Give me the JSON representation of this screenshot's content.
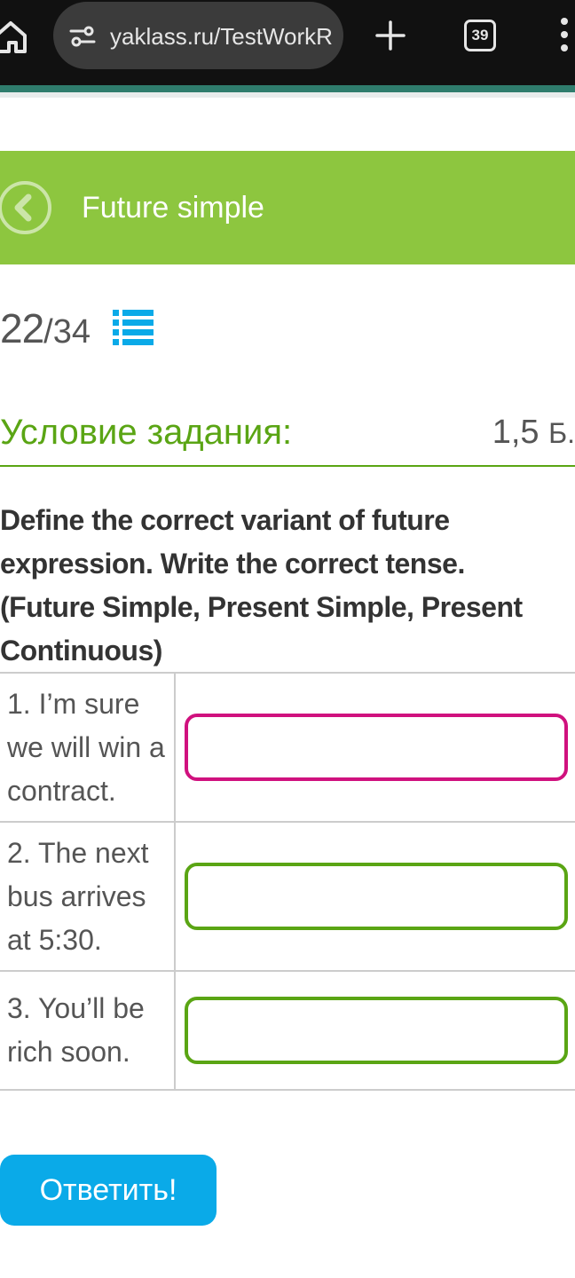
{
  "browser": {
    "url_display": "yaklass.ru/TestWorkRun",
    "tab_count": "39",
    "icons": [
      "home-icon",
      "tune-icon",
      "new-tab-icon",
      "tab-switcher-icon",
      "more-icon"
    ]
  },
  "topic": {
    "title": "Future simple"
  },
  "progress": {
    "current": "22",
    "total": "/34"
  },
  "condition": {
    "label": "Условие задания:",
    "points_value": "1,5",
    "points_unit": "Б."
  },
  "question": {
    "text": "Define the correct variant of future expression. Write the correct tense. (Future Simple, Present Simple, Present Continuous)"
  },
  "items": [
    {
      "sentence": "1. I’m sure we will win a contract.",
      "answer": "",
      "state": "focused"
    },
    {
      "sentence": "2.  The next bus arrives at 5:30.",
      "answer": "",
      "state": "default"
    },
    {
      "sentence": "3.  You’ll be rich soon.",
      "answer": "",
      "state": "default"
    }
  ],
  "actions": {
    "submit_label": "Ответить!"
  },
  "colors": {
    "chrome_bg": "#111111",
    "topic_bar": "#8dc63f",
    "accent_green": "#5aa514",
    "focus_pink": "#d0117e",
    "submit_blue": "#0aaae8",
    "list_icon_blue": "#0aaae8"
  }
}
